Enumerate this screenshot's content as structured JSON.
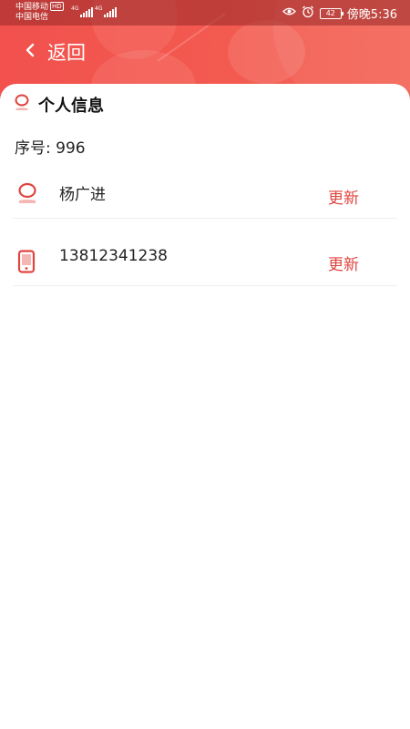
{
  "status_bar": {
    "carrier_1": "中国移动",
    "carrier_1_badge": "HD",
    "carrier_2": "中国电信",
    "network_1": "4G",
    "network_2": "4G",
    "battery_level": "42",
    "time": "傍晚5:36"
  },
  "nav": {
    "back_label": "返回"
  },
  "section": {
    "title": "个人信息"
  },
  "serial": {
    "text": "序号: 996"
  },
  "rows": [
    {
      "icon": "user-icon",
      "value": "杨广进",
      "action": "更新"
    },
    {
      "icon": "phone-icon",
      "value": "13812341238",
      "action": "更新"
    }
  ],
  "colors": {
    "header": "#f35a50",
    "accent": "#e0453f",
    "divider": "#eeeeee"
  }
}
